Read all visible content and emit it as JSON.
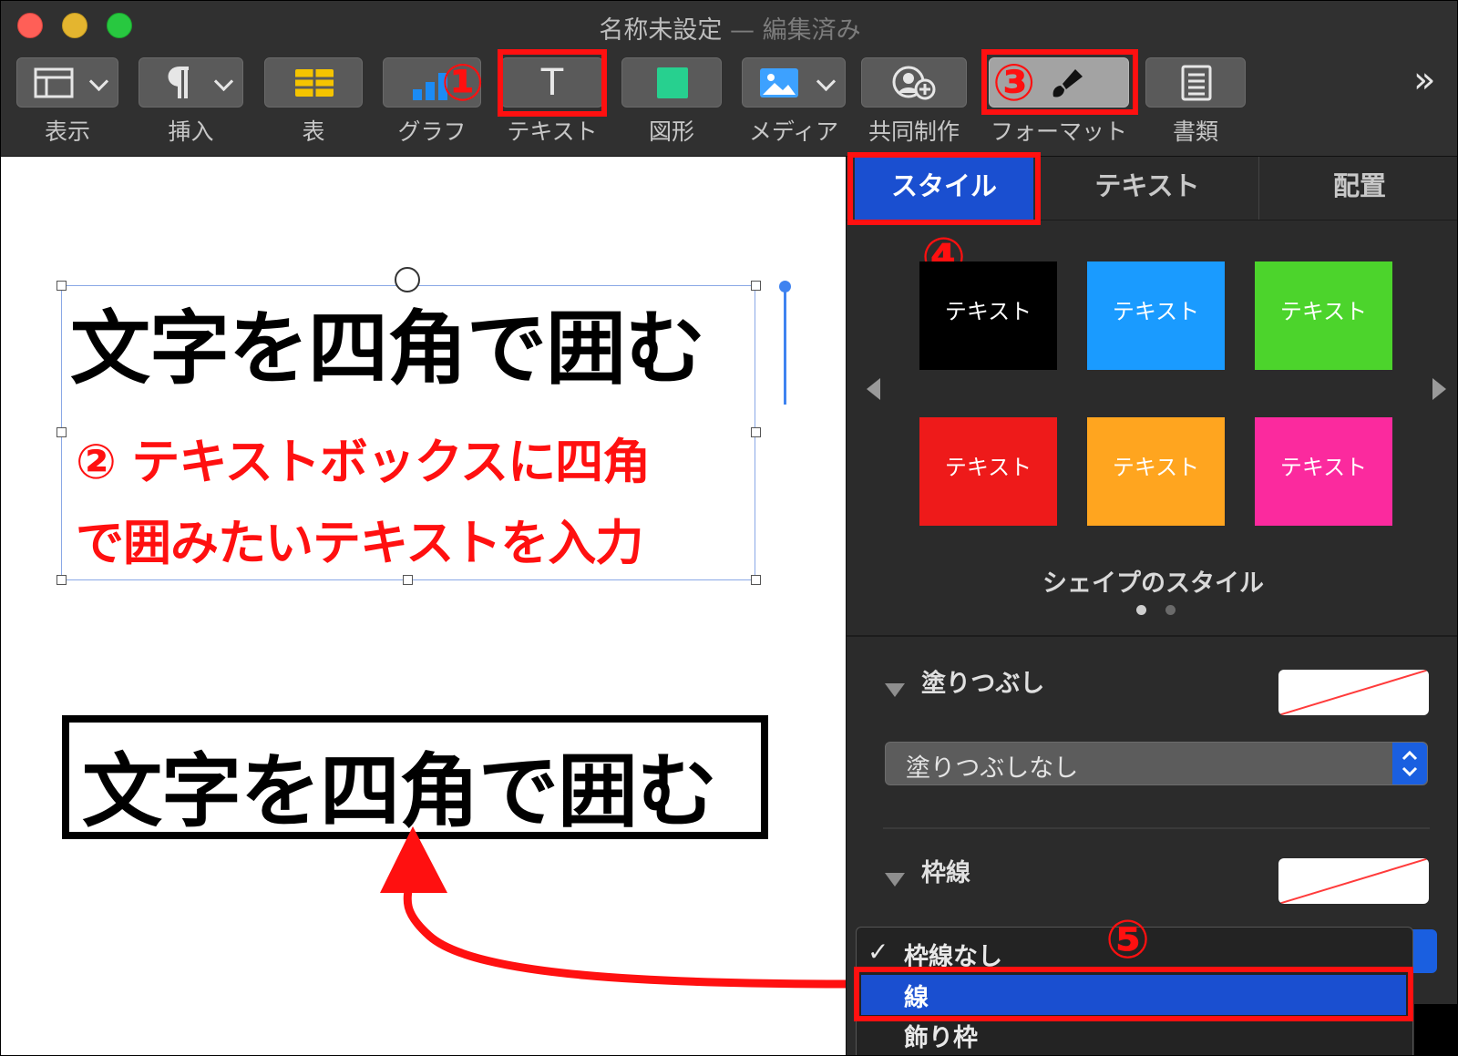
{
  "window": {
    "title": "名称未設定",
    "title_separator": "—",
    "edited": "編集済み"
  },
  "colors": {
    "close": "#ff5f57",
    "minimize": "#e4b52f",
    "zoom": "#28c840",
    "annotation_red": "#ff1010",
    "selection_blue": "#1a4fd0"
  },
  "toolbar": {
    "view_label": "表示",
    "insert_label": "挿入",
    "table_label": "表",
    "chart_label": "グラフ",
    "text_label": "テキスト",
    "text_glyph": "T",
    "shape_label": "図形",
    "media_label": "メディア",
    "collab_label": "共同制作",
    "format_label": "フォーマット",
    "document_label": "書類",
    "overflow_glyph": "»"
  },
  "annotations": {
    "n1": "①",
    "n2_text": "② テキストボックスに四角",
    "n2_text2": "で囲みたいテキストを入力",
    "n3": "③",
    "n4": "④",
    "n5": "⑤"
  },
  "canvas": {
    "textbox_text": "文字を四角で囲む",
    "result_text": "文字を四角で囲む"
  },
  "sidebar": {
    "tabs": [
      "スタイル",
      "テキスト",
      "配置"
    ],
    "swatches": [
      {
        "label": "テキスト",
        "color": "#000000"
      },
      {
        "label": "テキスト",
        "color": "#1a9bff"
      },
      {
        "label": "テキスト",
        "color": "#4cd42c"
      },
      {
        "label": "テキスト",
        "color": "#ee1a1a"
      },
      {
        "label": "テキスト",
        "color": "#ffa51f"
      },
      {
        "label": "テキスト",
        "color": "#fb2a9e"
      }
    ],
    "shape_styles_label": "シェイプのスタイル",
    "fill": {
      "title": "塗りつぶし",
      "popup_value": "塗りつぶしなし"
    },
    "border": {
      "title": "枠線",
      "menu_items": [
        "枠線なし",
        "線",
        "飾り枠"
      ],
      "check_glyph": "✓"
    }
  }
}
